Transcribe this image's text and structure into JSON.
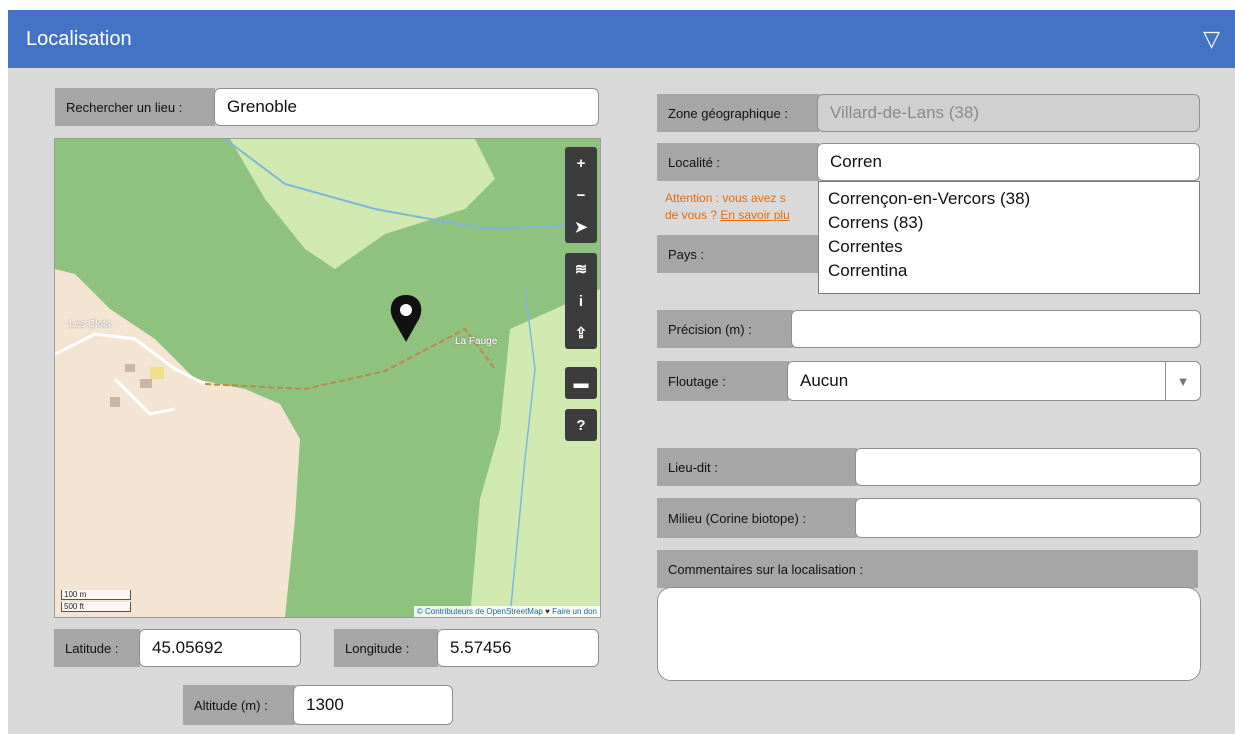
{
  "header": {
    "title": "Localisation",
    "toggle_icon": "▽"
  },
  "search": {
    "label": "Rechercher un lieu :",
    "value": "Grenoble"
  },
  "map": {
    "place_les_clots": "Les Clots",
    "place_la_fauge": "La Fauge",
    "scale_m": "100 m",
    "scale_ft": "500 ft",
    "attribution_link": "© Contributeurs de OpenStreetMap",
    "attribution_sep": "♥",
    "attribution_donate": "Faire un don",
    "controls": [
      "+",
      "−",
      "➤",
      "≋",
      "i",
      "⇪",
      "▬",
      "?"
    ]
  },
  "coords": {
    "latitude_label": "Latitude :",
    "latitude_value": "45.05692",
    "longitude_label": "Longitude :",
    "longitude_value": "5.57456",
    "altitude_label": "Altitude (m) :",
    "altitude_value": "1300"
  },
  "zone": {
    "label": "Zone géographique :",
    "value": "Villard-de-Lans (38)"
  },
  "localite": {
    "label": "Localité :",
    "value": "Corren",
    "options": [
      "Corrençon-en-Vercors (38)",
      "Correns (83)",
      "Correntes",
      "Correntina"
    ]
  },
  "warning": {
    "line1": "Attention : vous avez s",
    "line2_prefix": "de vous ? ",
    "link": "En savoir plu"
  },
  "pays": {
    "label": "Pays :"
  },
  "precision": {
    "label": "Précision (m) :",
    "value": ""
  },
  "floutage": {
    "label": "Floutage :",
    "value": "Aucun",
    "arrow": "▼"
  },
  "lieudit": {
    "label": "Lieu-dit :",
    "value": ""
  },
  "milieu": {
    "label": "Milieu (Corine biotope) :",
    "value": ""
  },
  "commentaires": {
    "label": "Commentaires sur la localisation :",
    "value": ""
  },
  "colors": {
    "header": "#4472c4",
    "panel": "#d9d9d9",
    "label_bg": "#a6a6a6",
    "warning": "#e46c0a"
  }
}
